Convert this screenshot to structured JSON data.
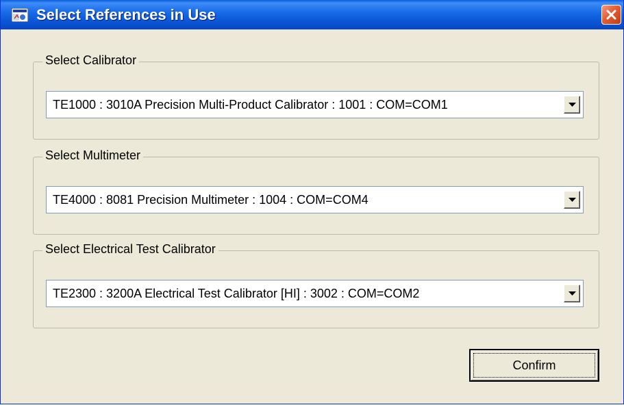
{
  "window": {
    "title": "Select References in Use",
    "icon": "app-icon",
    "close_icon": "close-icon"
  },
  "groups": [
    {
      "label": "Select Calibrator",
      "selected": "TE1000 : 3010A Precision Multi-Product Calibrator : 1001 : COM=COM1"
    },
    {
      "label": "Select Multimeter",
      "selected": "TE4000 : 8081 Precision Multimeter : 1004 : COM=COM4"
    },
    {
      "label": "Select Electrical Test Calibrator",
      "selected": "TE2300 : 3200A Electrical Test Calibrator [HI] : 3002 : COM=COM2"
    }
  ],
  "confirm_label": "Confirm",
  "colors": {
    "titlebar": "#0a58d6",
    "window_bg": "#ece9d8",
    "close_button": "#e35d36"
  }
}
